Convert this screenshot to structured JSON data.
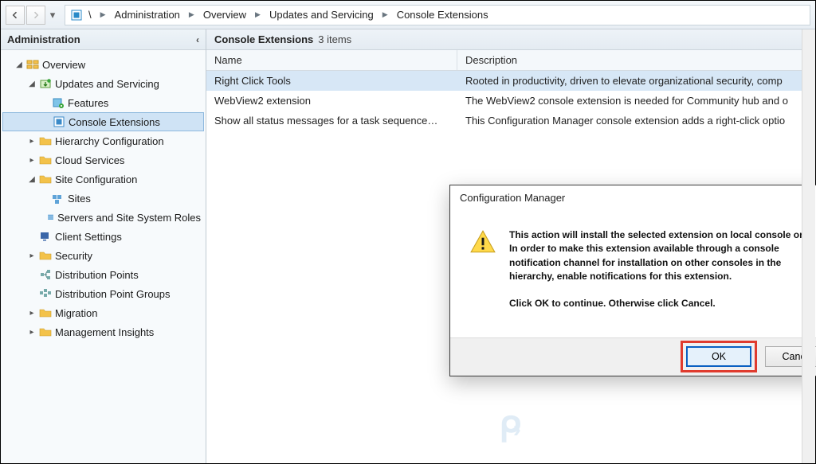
{
  "breadcrumb": {
    "items": [
      "Administration",
      "Overview",
      "Updates and Servicing",
      "Console Extensions"
    ]
  },
  "sidebar": {
    "title": "Administration",
    "tree": {
      "overview": "Overview",
      "updates_servicing": "Updates and Servicing",
      "features": "Features",
      "console_extensions": "Console Extensions",
      "hierarchy_config": "Hierarchy Configuration",
      "cloud_services": "Cloud Services",
      "site_config": "Site Configuration",
      "sites": "Sites",
      "servers_roles": "Servers and Site System Roles",
      "client_settings": "Client Settings",
      "security": "Security",
      "distribution_points": "Distribution Points",
      "distribution_point_groups": "Distribution Point Groups",
      "migration": "Migration",
      "management_insights": "Management Insights"
    }
  },
  "content": {
    "title": "Console Extensions",
    "count_label": "3 items",
    "columns": {
      "name": "Name",
      "description": "Description"
    },
    "rows": [
      {
        "name": "Right Click Tools",
        "description": "Rooted in productivity, driven to elevate organizational security, comp"
      },
      {
        "name": "WebView2 extension",
        "description": "The WebView2 console extension is needed for Community hub and o"
      },
      {
        "name": "Show all status messages for a task sequence…",
        "description": "This Configuration Manager console extension adds a right-click optio"
      }
    ]
  },
  "dialog": {
    "title": "Configuration Manager",
    "body1": "This action will install the selected extension on local console only. In order to make this extension available through a console notification channel for installation on other consoles in the hierarchy, enable notifications for this extension.",
    "body2": "Click OK to continue. Otherwise click Cancel.",
    "ok": "OK",
    "cancel": "Cancel"
  }
}
